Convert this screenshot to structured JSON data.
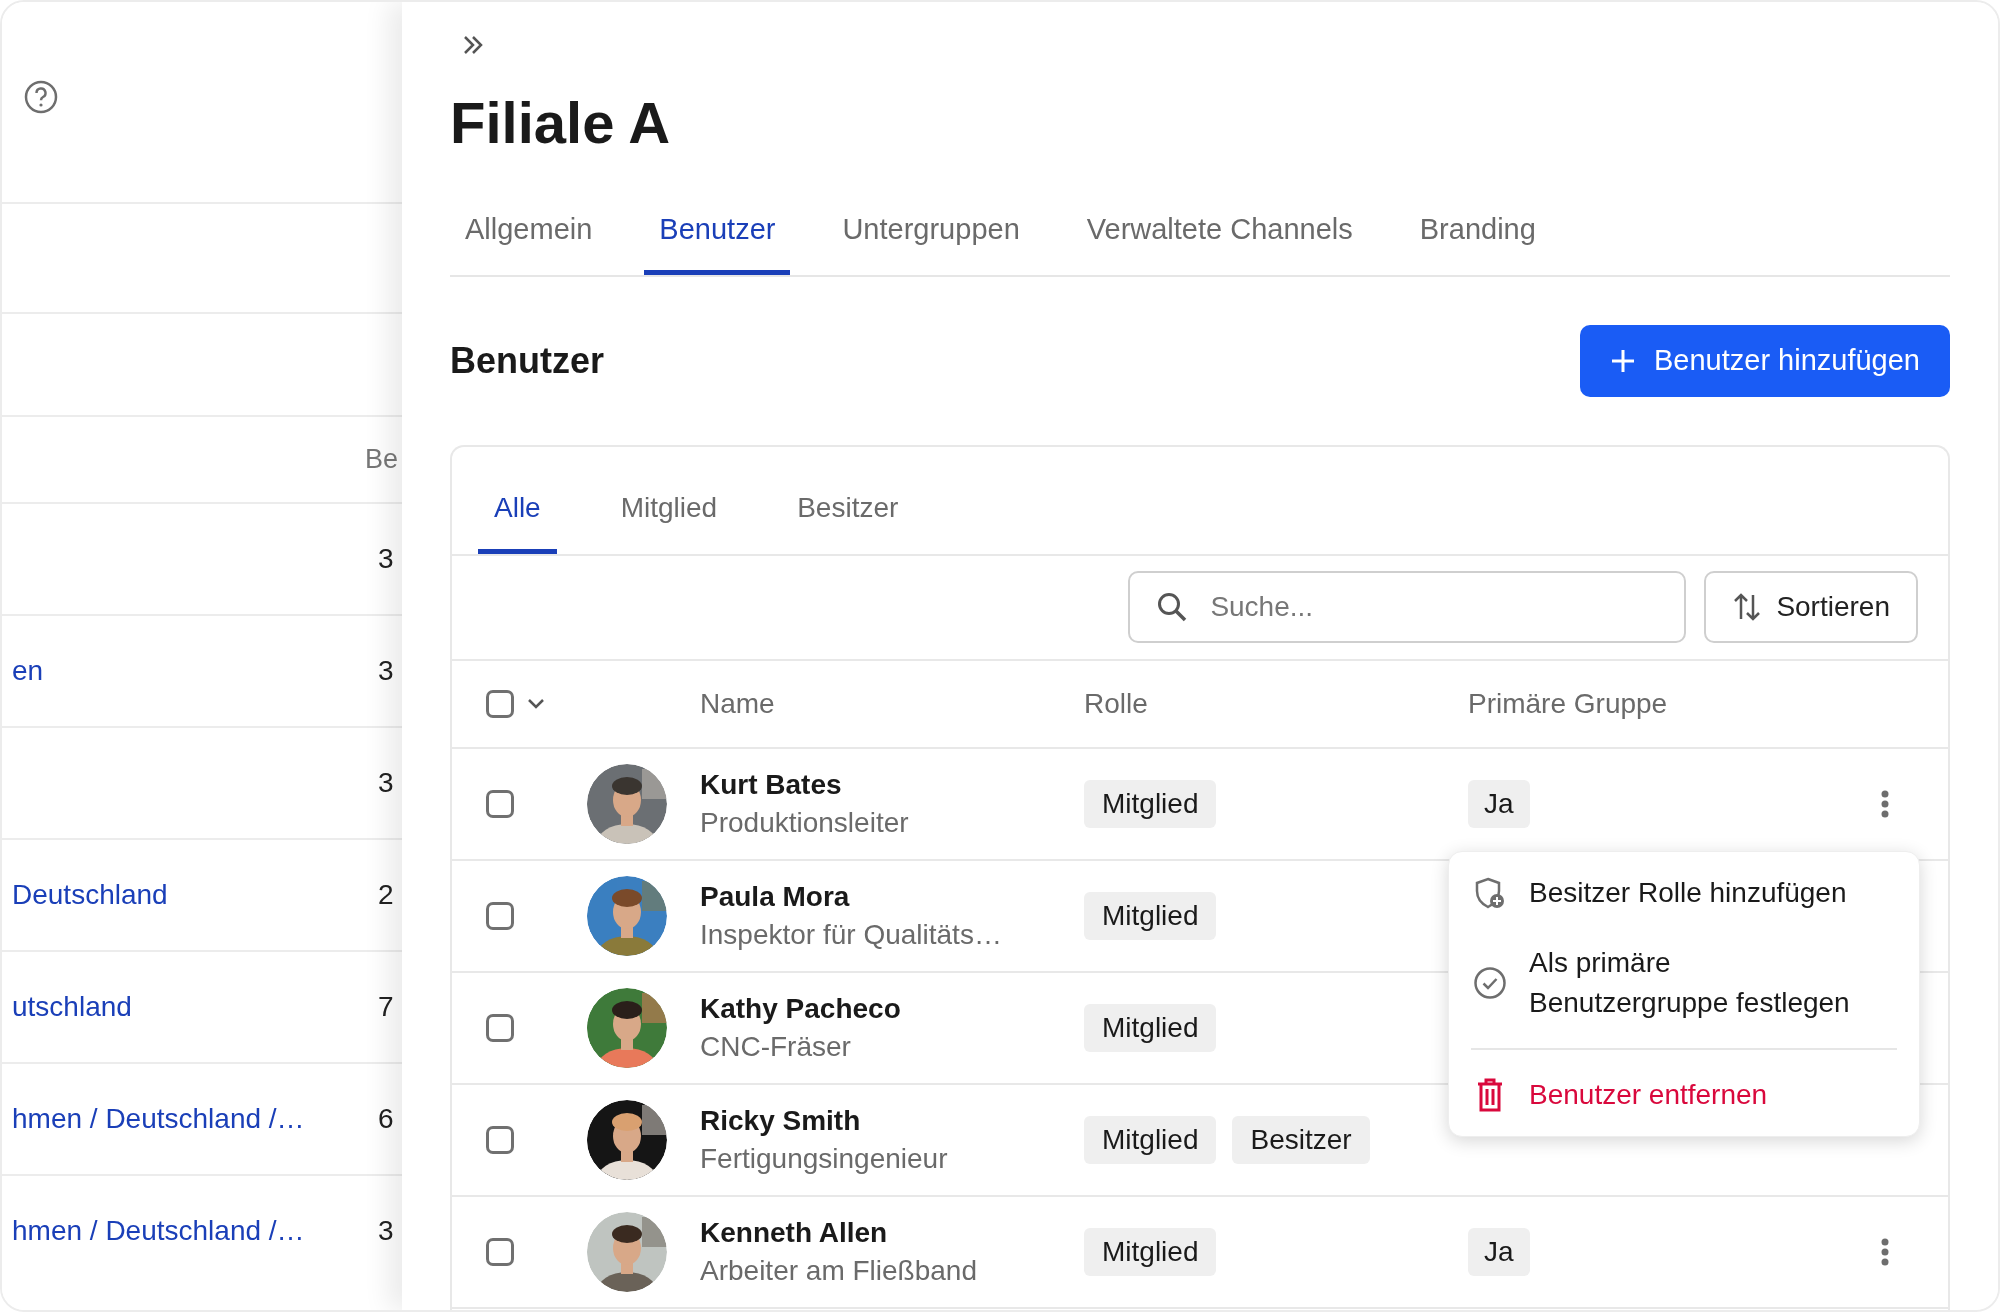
{
  "sidebar": {
    "column_header": "Be",
    "rows": [
      {
        "link": "",
        "count": "3"
      },
      {
        "link": "en",
        "count": "3"
      },
      {
        "link": "",
        "count": "3"
      },
      {
        "link": "Deutschland",
        "count": "2"
      },
      {
        "link": "utschland",
        "count": "7"
      },
      {
        "link": "hmen / Deutschland /…",
        "count": "6"
      },
      {
        "link": "hmen / Deutschland /…",
        "count": "3"
      }
    ]
  },
  "title": "Filiale A",
  "tabs": [
    {
      "label": "Allgemein",
      "selected": false
    },
    {
      "label": "Benutzer",
      "selected": true
    },
    {
      "label": "Untergruppen",
      "selected": false
    },
    {
      "label": "Verwaltete Channels",
      "selected": false
    },
    {
      "label": "Branding",
      "selected": false
    }
  ],
  "section_title": "Benutzer",
  "add_button": "Benutzer hinzufügen",
  "filter_tabs": [
    {
      "label": "Alle",
      "selected": true
    },
    {
      "label": "Mitglied",
      "selected": false
    },
    {
      "label": "Besitzer",
      "selected": false
    }
  ],
  "search": {
    "placeholder": "Suche..."
  },
  "sort_button": "Sortieren",
  "table": {
    "select_all_checked": false,
    "columns": [
      "Name",
      "Rolle",
      "Primäre Gruppe"
    ],
    "rows": [
      {
        "checked": false,
        "name": "Kurt Bates",
        "job": "Produktionsleiter",
        "roles": [
          "Mitglied"
        ],
        "primary_group": "Ja"
      },
      {
        "checked": false,
        "name": "Paula Mora",
        "job": "Inspektor für Qualitäts…",
        "roles": [
          "Mitglied"
        ]
      },
      {
        "checked": false,
        "name": "Kathy Pacheco",
        "job": "CNC-Fräser",
        "roles": [
          "Mitglied"
        ]
      },
      {
        "checked": false,
        "name": "Ricky Smith",
        "job": "Fertigungsingenieur",
        "roles": [
          "Mitglied",
          "Besitzer"
        ]
      },
      {
        "checked": false,
        "name": "Kenneth Allen",
        "job": "Arbeiter am Fließband",
        "roles": [
          "Mitglied"
        ],
        "primary_group": "Ja"
      }
    ]
  },
  "context_menu": {
    "items": [
      {
        "kind": "add-role",
        "label": "Besitzer Rolle hinzufügen"
      },
      {
        "kind": "set-primary",
        "label": "Als primäre Benutzergruppe festlegen"
      },
      {
        "kind": "remove",
        "label": "Benutzer entfernen"
      }
    ]
  }
}
